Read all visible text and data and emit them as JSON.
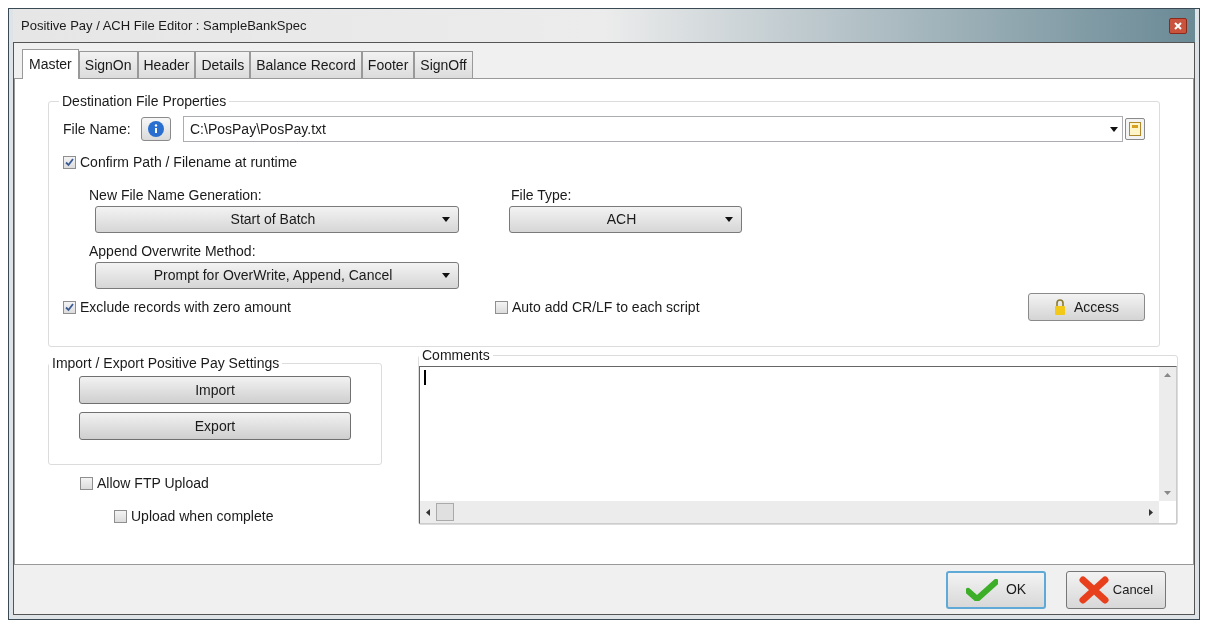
{
  "window": {
    "title": "Positive Pay / ACH File  Editor : SampleBankSpec"
  },
  "tabs": [
    {
      "label": "Master",
      "selected": true
    },
    {
      "label": "SignOn",
      "selected": false
    },
    {
      "label": "Header",
      "selected": false
    },
    {
      "label": "Details",
      "selected": false
    },
    {
      "label": "Balance Record",
      "selected": false
    },
    {
      "label": "Footer",
      "selected": false
    },
    {
      "label": "SignOff",
      "selected": false
    }
  ],
  "destination": {
    "title": "Destination File Properties",
    "file_name_label": "File Name:",
    "file_name": "C:\\PosPay\\PosPay.txt",
    "confirm": {
      "label": "Confirm  Path / Filename at runtime",
      "checked": true
    },
    "generation": {
      "label": "New File Name Generation:",
      "value": "Start of Batch"
    },
    "file_type": {
      "label": "File Type:",
      "value": "ACH"
    },
    "append": {
      "label": "Append Overwrite Method:",
      "value": "Prompt for OverWrite,  Append, Cancel"
    },
    "exclude": {
      "label": "Exclude records with zero amount",
      "checked": true
    },
    "auto_crlf": {
      "label": "Auto add CR/LF to each script",
      "checked": false
    },
    "access_button": "Access"
  },
  "import_export": {
    "title": "Import / Export Positive Pay Settings",
    "buttons": [
      "Import",
      "Export"
    ]
  },
  "ftp": {
    "allow": {
      "label": "Allow FTP Upload",
      "checked": false
    },
    "upload_complete": {
      "label": "Upload when complete",
      "checked": false
    }
  },
  "comments": {
    "title": "Comments"
  },
  "buttons": {
    "ok": "OK",
    "cancel": "Cancel"
  }
}
